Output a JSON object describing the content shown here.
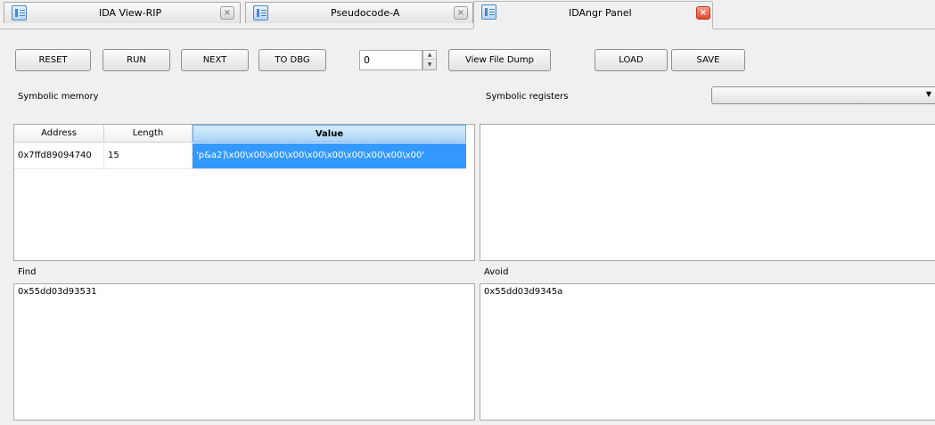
{
  "tabs": [
    {
      "title": "IDA View-RIP",
      "close": "×"
    },
    {
      "title": "Pseudocode-A",
      "close": "×"
    },
    {
      "title": "IDAngr Panel",
      "close": "×"
    }
  ],
  "toolbar": {
    "reset": "RESET",
    "run": "RUN",
    "next": "NEXT",
    "to_dbg": "TO DBG",
    "step_value": "0",
    "view_file_dump": "View File Dump",
    "load": "LOAD",
    "save": "SAVE"
  },
  "labels": {
    "symbolic_memory": "Symbolic memory",
    "symbolic_registers": "Symbolic registers",
    "find": "Find",
    "avoid": "Avoid"
  },
  "memory_table": {
    "columns": [
      "Address",
      "Length",
      "Value"
    ],
    "rows": [
      {
        "address": "0x7ffd89094740",
        "length": "15",
        "value": "'p&a2]\\x00\\x00\\x00\\x00\\x00\\x00\\x00\\x00\\x00\\x00'"
      }
    ]
  },
  "registers_combo": {
    "selected": ""
  },
  "find": {
    "text": "0x55dd03d93531"
  },
  "avoid": {
    "text": "0x55dd03d9345a"
  },
  "colors": {
    "selection": "#3399ff",
    "close_active": "#e0452a"
  }
}
